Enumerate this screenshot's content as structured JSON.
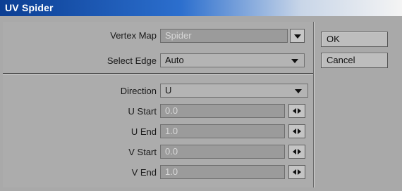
{
  "window": {
    "title": "UV Spider"
  },
  "top_fields": [
    {
      "label": "Vertex Map",
      "value": "Spider"
    },
    {
      "label": "Select Edge",
      "value": "Auto"
    }
  ],
  "direction": {
    "label": "Direction",
    "value": "U"
  },
  "numeric_fields": [
    {
      "label": "U Start",
      "value": "0.0"
    },
    {
      "label": "U End",
      "value": "1.0"
    },
    {
      "label": "V Start",
      "value": "0.0"
    },
    {
      "label": "V End",
      "value": "1.0"
    }
  ],
  "buttons": {
    "ok": "OK",
    "cancel": "Cancel"
  },
  "colors": {
    "title_bar": "#0b3e93",
    "panel": "#a9a9a9",
    "disabled_field": "#9b9b9b"
  }
}
